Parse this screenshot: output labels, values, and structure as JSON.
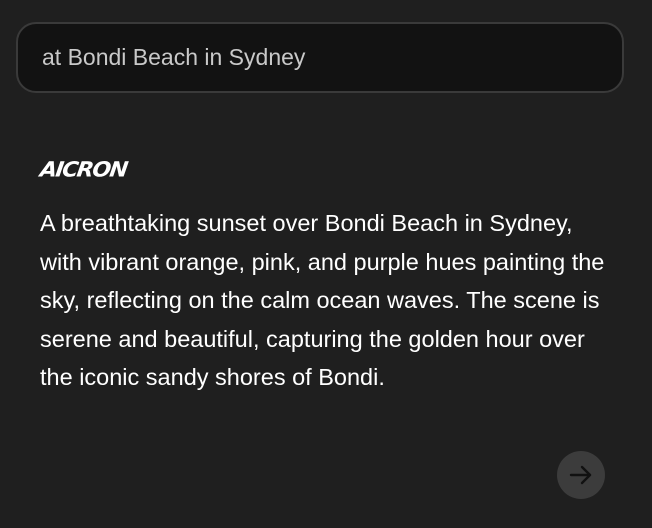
{
  "search": {
    "value": "at Bondi Beach in Sydney"
  },
  "brand": {
    "logo_text": "AICRON"
  },
  "response": {
    "text": "A breathtaking sunset over Bondi Beach in Sydney, with vibrant orange, pink, and purple hues painting the sky, reflecting on the calm ocean waves. The scene is serene and beautiful, capturing the golden hour over the iconic sandy shores of Bondi."
  },
  "icons": {
    "next": "arrow-right-icon"
  },
  "colors": {
    "background": "#1f1f1f",
    "input_background": "#121212",
    "input_border": "#3a3a3a",
    "text": "#ffffff",
    "button_background": "#3c3c3c",
    "icon": "#111111"
  }
}
